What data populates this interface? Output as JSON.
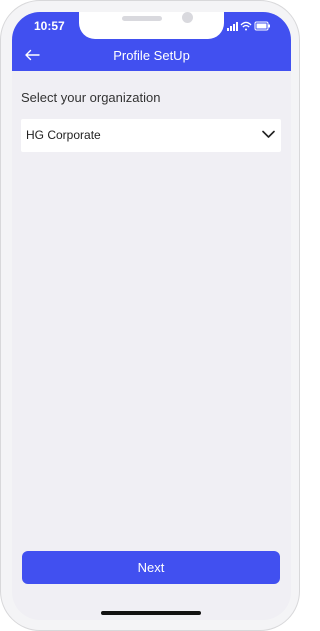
{
  "status_bar": {
    "time": "10:57"
  },
  "header": {
    "title": "Profile SetUp"
  },
  "organization": {
    "label": "Select your organization",
    "selected": "HG Corporate"
  },
  "footer": {
    "next_label": "Next"
  },
  "colors": {
    "primary": "#4150f0",
    "background": "#f0eff4"
  },
  "icons": {
    "back": "arrow-left-icon",
    "dropdown": "chevron-down-icon",
    "signal": "signal-icon",
    "wifi": "wifi-icon",
    "battery": "battery-icon"
  }
}
